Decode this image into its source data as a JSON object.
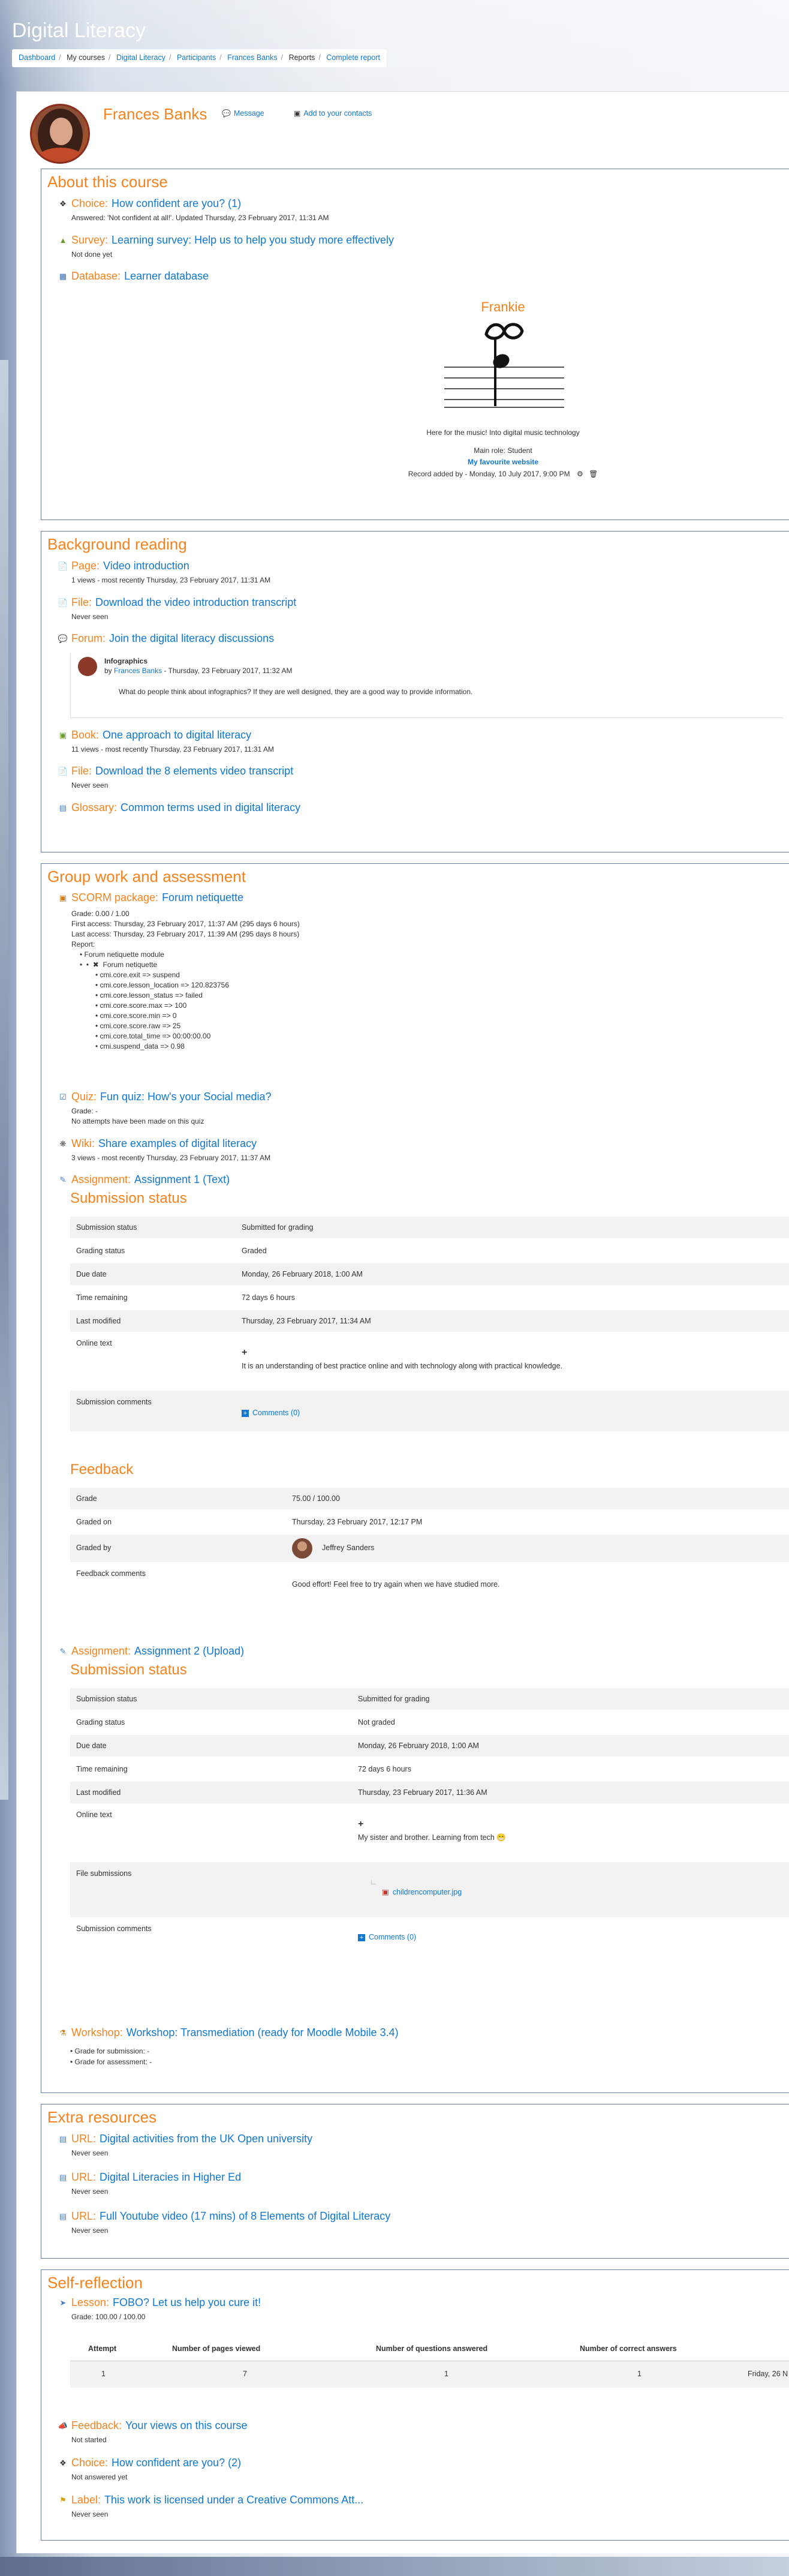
{
  "site": {
    "title": "Digital Literacy"
  },
  "breadcrumb": [
    "Dashboard",
    "My courses",
    "Digital Literacy",
    "Participants",
    "Frances Banks",
    "Reports",
    "Complete report"
  ],
  "profile": {
    "name": "Frances Banks",
    "message": "Message",
    "add_contact": "Add to your contacts"
  },
  "colors": {
    "accent": "#f4831f",
    "link": "#1177d1",
    "border": "#6a7da0"
  },
  "about": {
    "heading": "About this course",
    "choice1": {
      "type": "Choice:",
      "name": "How confident are you? (1)",
      "meta": "Answered: 'Not confident at all!'. Updated Thursday, 23 February 2017, 11:31 AM",
      "icon": "choice-icon"
    },
    "survey": {
      "type": "Survey:",
      "name": "Learning survey: Help us to help you study more effectively",
      "meta": "Not done yet",
      "icon": "survey-icon"
    },
    "database": {
      "type": "Database:",
      "name": "Learner database",
      "icon": "database-icon",
      "record": {
        "title": "Frankie",
        "desc": "Here for the music! Into digital music technology",
        "role": "Main role: Student",
        "website": "My favourite website",
        "added": "Record added by - Monday, 10 July 2017, 9:00 PM"
      }
    }
  },
  "background": {
    "heading": "Background reading",
    "page": {
      "type": "Page:",
      "name": "Video introduction",
      "meta": "1 views - most recently Thursday, 23 February 2017, 11:31 AM"
    },
    "file1": {
      "type": "File:",
      "name": "Download the video introduction transcript",
      "meta": "Never seen"
    },
    "forum": {
      "type": "Forum:",
      "name": "Join the digital literacy discussions",
      "post": {
        "title": "Infographics",
        "by": "by",
        "author": "Frances Banks",
        "date": " - Thursday, 23 February 2017, 11:32 AM",
        "body": "What do people think about infographics? If they are well designed, they are a good way to provide information."
      }
    },
    "book": {
      "type": "Book:",
      "name": "One approach to digital literacy",
      "meta": "11 views - most recently Thursday, 23 February 2017, 11:31 AM"
    },
    "file2": {
      "type": "File:",
      "name": "Download the 8 elements video transcript",
      "meta": "Never seen"
    },
    "glossary": {
      "type": "Glossary:",
      "name": "Common terms used in digital literacy"
    }
  },
  "group": {
    "heading": "Group work and assessment",
    "scorm": {
      "type": "SCORM package:",
      "name": "Forum netiquette",
      "lines": [
        "Grade: 0.00 / 1.00",
        "First access: Thursday, 23 February 2017, 11:37 AM (295 days 6 hours)",
        "Last access: Thursday, 23 February 2017, 11:39 AM (295 days 8 hours)",
        "Report:"
      ],
      "module": "Forum netiquette module",
      "sco": "Forum netiquette",
      "items": [
        "cmi.core.exit => suspend",
        "cmi.core.lesson_location => 120.823756",
        "cmi.core.lesson_status => failed",
        "cmi.core.score.max => 100",
        "cmi.core.score.min => 0",
        "cmi.core.score.raw => 25",
        "cmi.core.total_time => 00:00:00.00",
        "cmi.suspend_data => 0.98"
      ]
    },
    "quiz": {
      "type": "Quiz:",
      "name": "Fun quiz: How's your Social media?",
      "lines": [
        "Grade: -",
        "No attempts have been made on this quiz"
      ]
    },
    "wiki": {
      "type": "Wiki:",
      "name": "Share examples of digital literacy",
      "meta": "3 views - most recently Thursday, 23 February 2017, 11:37 AM"
    },
    "assign1": {
      "type": "Assignment:",
      "name": "Assignment 1 (Text)",
      "status_heading": "Submission status",
      "rows": [
        [
          "Submission status",
          "Submitted for grading"
        ],
        [
          "Grading status",
          "Graded"
        ],
        [
          "Due date",
          "Monday, 26 February 2018, 1:00 AM"
        ],
        [
          "Time remaining",
          "72 days 6 hours"
        ],
        [
          "Last modified",
          "Thursday, 23 February 2017, 11:34 AM"
        ],
        [
          "Online text",
          "It is an understanding of best practice online and with technology along with practical knowledge."
        ],
        [
          "Submission comments",
          "Comments (0)"
        ]
      ],
      "feedback_heading": "Feedback",
      "feedback": [
        [
          "Grade",
          "75.00 / 100.00"
        ],
        [
          "Graded on",
          "Thursday, 23 February 2017, 12:17 PM"
        ],
        [
          "Graded by",
          "Jeffrey Sanders"
        ],
        [
          "Feedback comments",
          "Good effort! Feel free to try again when we have studied more."
        ]
      ]
    },
    "assign2": {
      "type": "Assignment:",
      "name": "Assignment 2 (Upload)",
      "status_heading": "Submission status",
      "rows": [
        [
          "Submission status",
          "Submitted for grading"
        ],
        [
          "Grading status",
          "Not graded"
        ],
        [
          "Due date",
          "Monday, 26 February 2018, 1:00 AM"
        ],
        [
          "Time remaining",
          "72 days 6 hours"
        ],
        [
          "Last modified",
          "Thursday, 23 February 2017, 11:36 AM"
        ],
        [
          "Online text",
          "My sister and brother. Learning from tech"
        ],
        [
          "File submissions",
          "childrencomputer.jpg"
        ],
        [
          "Submission comments",
          "Comments (0)"
        ]
      ]
    },
    "workshop": {
      "type": "Workshop:",
      "name": "Workshop: Transmediation (ready for Moodle Mobile 3.4)",
      "items": [
        "Grade for submission: -",
        "Grade for assessment: -"
      ]
    }
  },
  "extra": {
    "heading": "Extra resources",
    "url1": {
      "type": "URL:",
      "name": "Digital activities from the UK Open university",
      "meta": "Never seen"
    },
    "url2": {
      "type": "URL:",
      "name": "Digital Literacies in Higher Ed",
      "meta": "Never seen"
    },
    "url3": {
      "type": "URL:",
      "name": "Full Youtube video (17 mins) of 8 Elements of Digital Literacy",
      "meta": "Never seen"
    }
  },
  "reflection": {
    "heading": "Self-reflection",
    "lesson": {
      "type": "Lesson:",
      "name": "FOBO? Let us help you cure it!",
      "meta": "Grade: 100.00 / 100.00",
      "headers": [
        "Attempt",
        "Number of pages viewed",
        "Number of questions answered",
        "Number of correct answers"
      ],
      "row": [
        "1",
        "7",
        "1",
        "1",
        "Friday, 26 N"
      ]
    },
    "feedback": {
      "type": "Feedback:",
      "name": "Your views on this course",
      "meta": "Not started"
    },
    "choice2": {
      "type": "Choice:",
      "name": "How confident are you? (2)",
      "meta": "Not answered yet"
    },
    "label": {
      "type": "Label:",
      "name": "This work is licensed under a Creative Commons Att...",
      "meta": "Never seen"
    }
  }
}
